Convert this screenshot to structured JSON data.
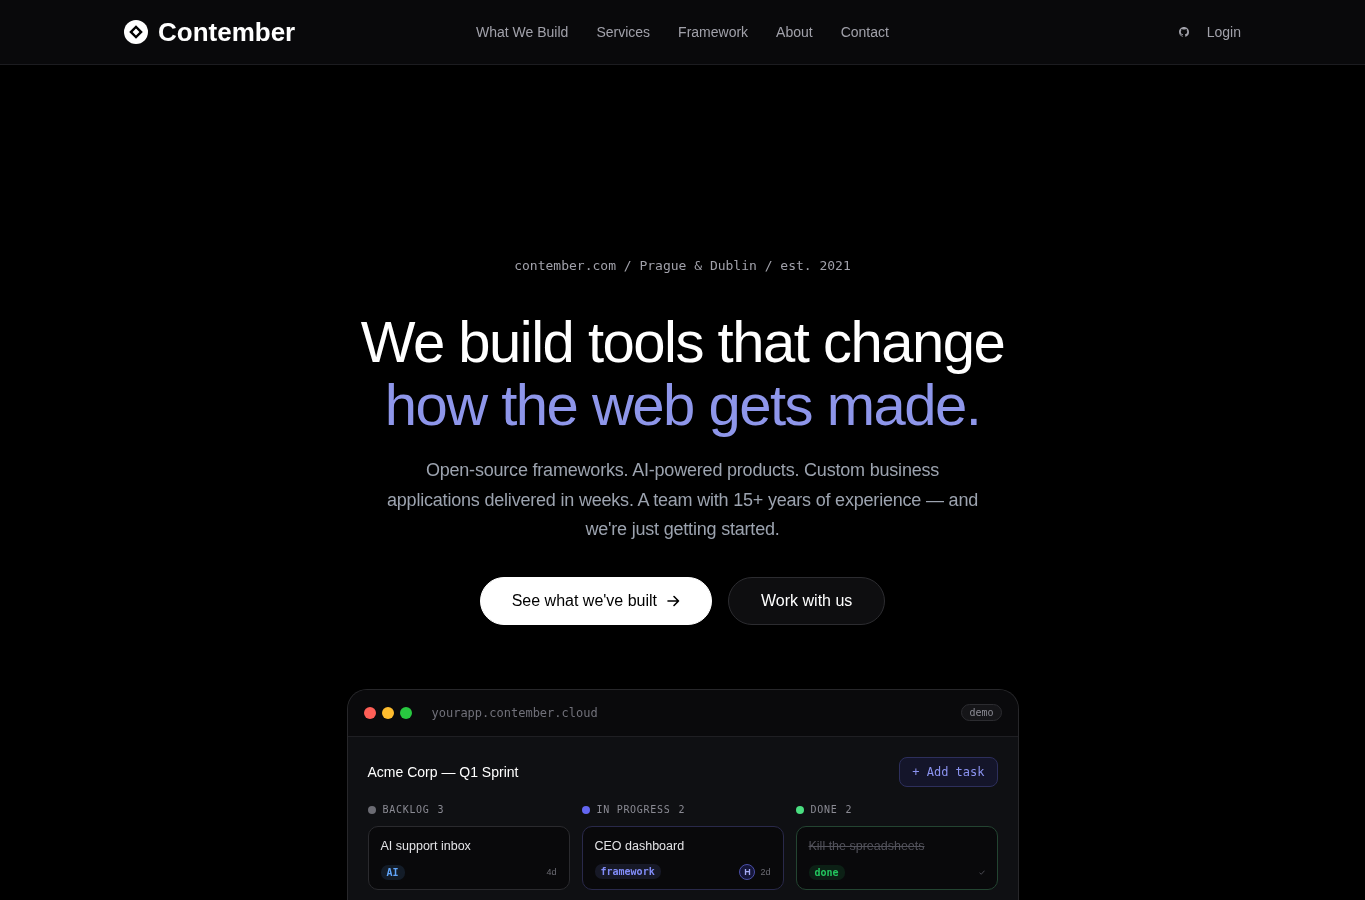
{
  "header": {
    "logo": "Contember",
    "nav": [
      "What We Build",
      "Services",
      "Framework",
      "About",
      "Contact"
    ],
    "login": "Login"
  },
  "hero": {
    "eyebrow": "contember.com / Prague & Dublin / est. 2021",
    "headline": {
      "text": "We build tools that change",
      "accent": "how the web gets made."
    },
    "subtitle": "Open-source frameworks. AI-powered products. Custom business applications delivered in weeks. A team with 15+ years of experience — and we're just getting started.",
    "buttons": [
      {
        "label": "See what we've built",
        "kind": "primary"
      },
      {
        "label": "Work with us",
        "kind": "secondary"
      }
    ]
  },
  "demo_window": {
    "traffic_lights": [
      {
        "color": "#ff5f57"
      },
      {
        "color": "#febc2e"
      },
      {
        "color": "#28c840"
      }
    ],
    "url": "yourapp.contember.cloud",
    "badge": "demo",
    "board_title": "Acme Corp — Q1 Sprint",
    "add_button": "+ Add task",
    "columns": [
      {
        "name": "BACKLOG",
        "count": "3",
        "color": "#6b6b73",
        "cards": [
          {
            "title": "AI support inbox",
            "tag": {
              "label": "AI",
              "color": "#60a5fa"
            },
            "age": "4d",
            "done": false
          }
        ]
      },
      {
        "name": "IN PROGRESS",
        "count": "2",
        "color": "#6366f1",
        "cards": [
          {
            "title": "CEO dashboard",
            "tag": {
              "label": "framework",
              "color": "#818cf8"
            },
            "assignee": "H",
            "age": "2d",
            "done": false
          }
        ]
      },
      {
        "name": "DONE",
        "count": "2",
        "color": "#4ade80",
        "cards": [
          {
            "title": "Kill the spreadsheets",
            "tag": {
              "label": "done",
              "color": "#22c55e"
            },
            "done": true
          }
        ]
      }
    ]
  }
}
